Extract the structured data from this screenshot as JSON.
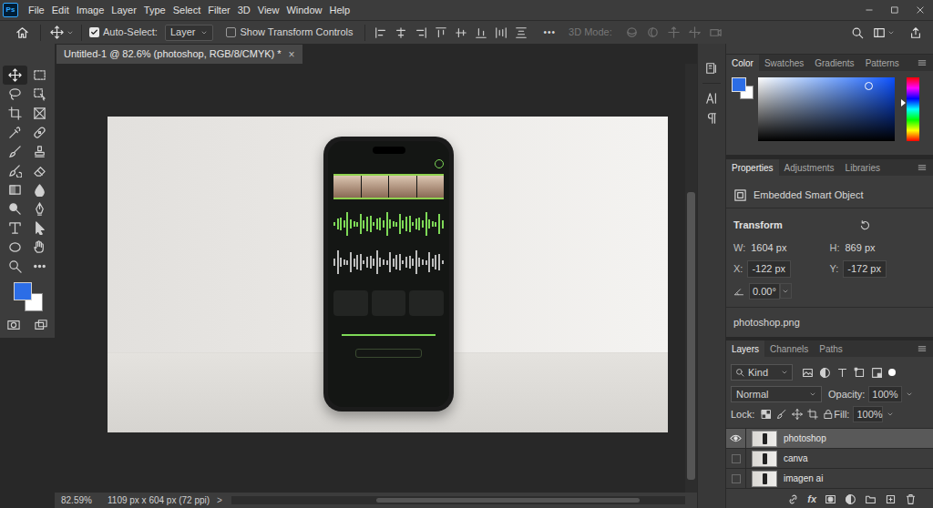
{
  "app": {
    "logo": "Ps"
  },
  "menu": [
    "File",
    "Edit",
    "Image",
    "Layer",
    "Type",
    "Select",
    "Filter",
    "3D",
    "View",
    "Window",
    "Help"
  ],
  "options_bar": {
    "auto_select": {
      "label": "Auto-Select:",
      "checked": true
    },
    "target": "Layer",
    "transform_controls": {
      "label": "Show Transform Controls",
      "checked": false
    },
    "more": "•••",
    "mode_3d": {
      "label": "3D Mode:",
      "disabled": true
    }
  },
  "tools": [
    {
      "selected": true
    },
    {
      "selected": false
    },
    {
      "selected": false
    },
    {
      "selected": false
    },
    {
      "selected": false
    },
    {
      "selected": false
    },
    {
      "selected": false
    },
    {
      "selected": false
    },
    {
      "selected": false
    },
    {
      "selected": false
    },
    {
      "selected": false
    },
    {
      "selected": false
    },
    {
      "selected": false
    },
    {
      "selected": false
    },
    {
      "selected": false
    },
    {
      "selected": false
    },
    {
      "selected": false
    },
    {
      "selected": false
    },
    {
      "selected": false
    },
    {
      "selected": false
    },
    {
      "selected": false
    },
    {
      "selected": false
    }
  ],
  "swatches": {
    "foreground_color": "#2c6de6",
    "background_color": "#ffffff"
  },
  "document": {
    "tab": "Untitled-1 @ 82.6% (photoshop, RGB/8/CMYK) *",
    "close": "×"
  },
  "scroll": {
    "vertical": {
      "level": 0.67
    },
    "horizontal": {
      "level": 0.58
    }
  },
  "status_bar": {
    "zoom": "82.59%",
    "size": "1109 px x 604 px (72 ppi)",
    "arrow": ">"
  },
  "color_panel": {
    "tabs": [
      {
        "label": "Color",
        "selected": true
      },
      {
        "label": "Swatches",
        "selected": false
      },
      {
        "label": "Gradients",
        "selected": false
      },
      {
        "label": "Patterns",
        "selected": false
      }
    ]
  },
  "properties_panel": {
    "tabs": [
      {
        "label": "Properties",
        "selected": true
      },
      {
        "label": "Adjustments",
        "selected": false
      },
      {
        "label": "Libraries",
        "selected": false
      }
    ],
    "object_type": "Embedded Smart Object",
    "section": "Transform",
    "size": [
      {
        "label": "W:",
        "value": "1604 px"
      },
      {
        "label": "H:",
        "value": "869 px"
      }
    ],
    "position": [
      {
        "label": "X:",
        "value": "-122 px"
      },
      {
        "label": "Y:",
        "value": "-172 px"
      }
    ],
    "angle": "0.00°",
    "file": "photoshop.png"
  },
  "layers_panel": {
    "tabs": [
      {
        "label": "Layers",
        "selected": true
      },
      {
        "label": "Channels",
        "selected": false
      },
      {
        "label": "Paths",
        "selected": false
      }
    ],
    "filter": "Kind",
    "blend_mode": "Normal",
    "opacity_label": "Opacity:",
    "opacity": "100%",
    "lock_label": "Lock:",
    "fill_label": "Fill:",
    "fill": "100%",
    "layers": [
      {
        "name": "photoshop",
        "visible": true,
        "selected": true
      },
      {
        "name": "canva",
        "visible": false,
        "selected": false
      },
      {
        "name": "imagen ai",
        "visible": false,
        "selected": false
      }
    ],
    "fx": "fx"
  }
}
